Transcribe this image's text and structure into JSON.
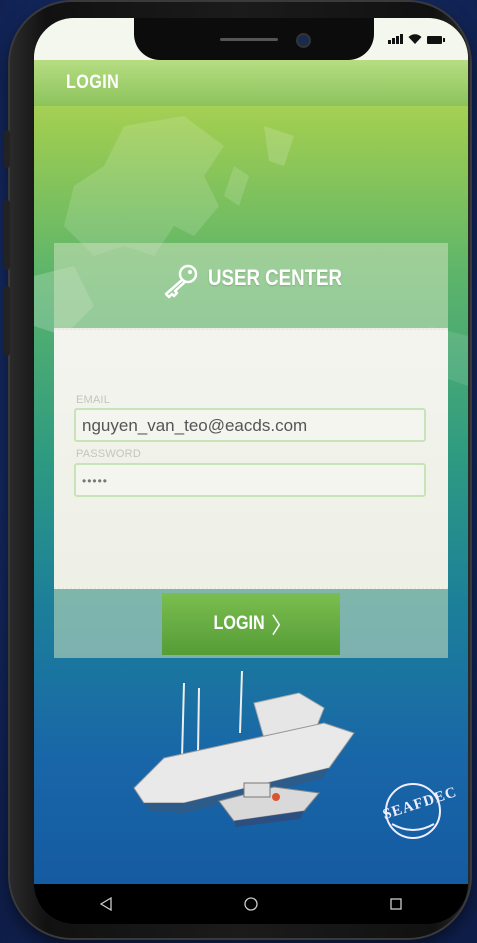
{
  "status_bar": {
    "signal_icon": "cellular-signal-icon",
    "wifi_icon": "wifi-icon",
    "battery_icon": "battery-icon"
  },
  "header": {
    "title": "LOGIN"
  },
  "panel": {
    "icon": "key-icon",
    "title": "USER CENTER",
    "email": {
      "label": "EMAIL",
      "value": "nguyen_van_teo@eacds.com"
    },
    "password": {
      "label": "PASSWORD",
      "value": "•••••"
    },
    "login_button": {
      "label": "LOGIN",
      "icon": "chevron-right-icon",
      "chevron": "〉"
    }
  },
  "logo": {
    "text": "SEAFDEC"
  },
  "nav_bar": {
    "back_icon": "back-triangle-icon",
    "home_icon": "home-circle-icon",
    "recents_icon": "recents-square-icon"
  },
  "colors": {
    "header_green": "#8cc35c",
    "button_green": "#559d37",
    "panel_overlay": "#cde1be"
  }
}
